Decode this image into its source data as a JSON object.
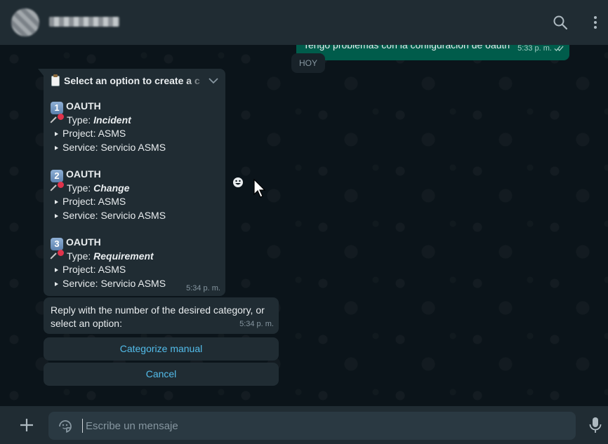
{
  "header": {
    "contact_name": "contacto",
    "icons": [
      "search-icon",
      "menu-icon"
    ]
  },
  "chat": {
    "outgoing": {
      "text": "Tengo problemas con la configuración de oauth",
      "time": "5:33 p. m.",
      "status_icon": "double-check-icon"
    },
    "day_chip": "HOY",
    "list_message": {
      "title": "Select an option to create a c",
      "time": "5:34 p. m.",
      "type_label": "Type:",
      "project_prefix": "Project:",
      "service_prefix": "Service:",
      "items": [
        {
          "number": "1",
          "name": "OAUTH",
          "type": "Incident",
          "project": "ASMS",
          "service": "Servicio ASMS"
        },
        {
          "number": "2",
          "name": "OAUTH",
          "type": "Change",
          "project": "ASMS",
          "service": "Servicio ASMS"
        },
        {
          "number": "3",
          "name": "OAUTH",
          "type": "Requirement",
          "project": "ASMS",
          "service": "Servicio ASMS"
        }
      ]
    },
    "reply_message": {
      "text": "Reply with the number of the desired category, or select an option:",
      "time": "5:34 p. m."
    },
    "buttons": {
      "categorize": "Categorize manual",
      "cancel": "Cancel"
    }
  },
  "footer": {
    "placeholder": "Escribe un mensaje"
  },
  "colors": {
    "header_bg": "#202c33",
    "chat_bg": "#0b141a",
    "incoming_bubble": "#202c33",
    "outgoing_bubble": "#005c4b",
    "link_blue": "#53bdeb"
  }
}
